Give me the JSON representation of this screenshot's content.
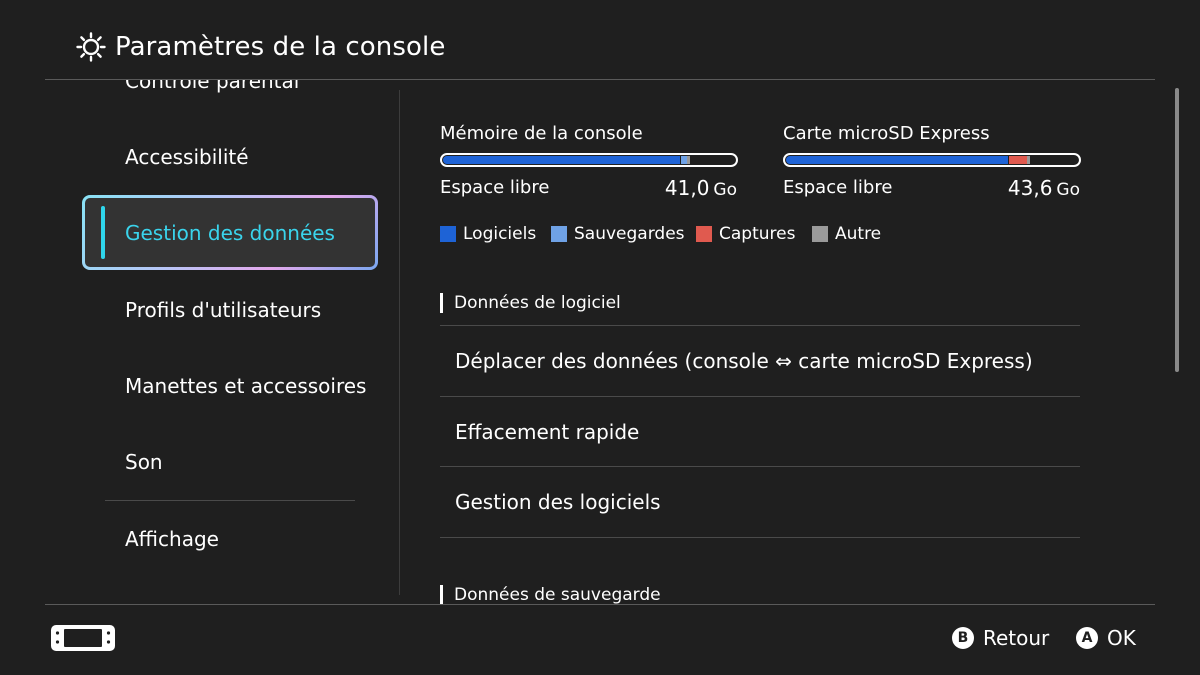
{
  "header": {
    "title": "Paramètres de la console",
    "icon": "gear-icon"
  },
  "sidebar": {
    "items": [
      {
        "label": "Contrôle parental"
      },
      {
        "label": "Accessibilité"
      },
      {
        "label": "Gestion des données"
      },
      {
        "label": "Profils d'utilisateurs"
      },
      {
        "label": "Manettes et accessoires"
      },
      {
        "label": "Son"
      },
      {
        "label": "Affichage"
      }
    ],
    "selected_index": 2
  },
  "storage": {
    "console": {
      "title": "Mémoire de la console",
      "free_label": "Espace libre",
      "free_value": "41,0",
      "unit": "Go",
      "used_fraction": {
        "logiciels": 0.81,
        "sauvegardes": 0.02,
        "captures": 0.0,
        "autre": 0.01
      }
    },
    "sd": {
      "title": "Carte microSD Express",
      "free_label": "Espace libre",
      "free_value": "43,6",
      "unit": "Go",
      "used_fraction": {
        "logiciels": 0.76,
        "sauvegardes": 0.0,
        "captures": 0.06,
        "autre": 0.01
      }
    },
    "legend": [
      {
        "label": "Logiciels",
        "color": "#1e63d6"
      },
      {
        "label": "Sauvegardes",
        "color": "#6fa2e6"
      },
      {
        "label": "Captures",
        "color": "#e05a4f"
      },
      {
        "label": "Autre",
        "color": "#9a9a9a"
      }
    ]
  },
  "sections": {
    "software": {
      "header": "Données de logiciel",
      "items": [
        {
          "label": "Déplacer des données (console ⇔ carte microSD Express)"
        },
        {
          "label": "Effacement rapide"
        },
        {
          "label": "Gestion des logiciels"
        }
      ]
    },
    "save": {
      "header": "Données de sauvegarde"
    }
  },
  "footer": {
    "back": {
      "button": "B",
      "label": "Retour"
    },
    "ok": {
      "button": "A",
      "label": "OK"
    }
  }
}
